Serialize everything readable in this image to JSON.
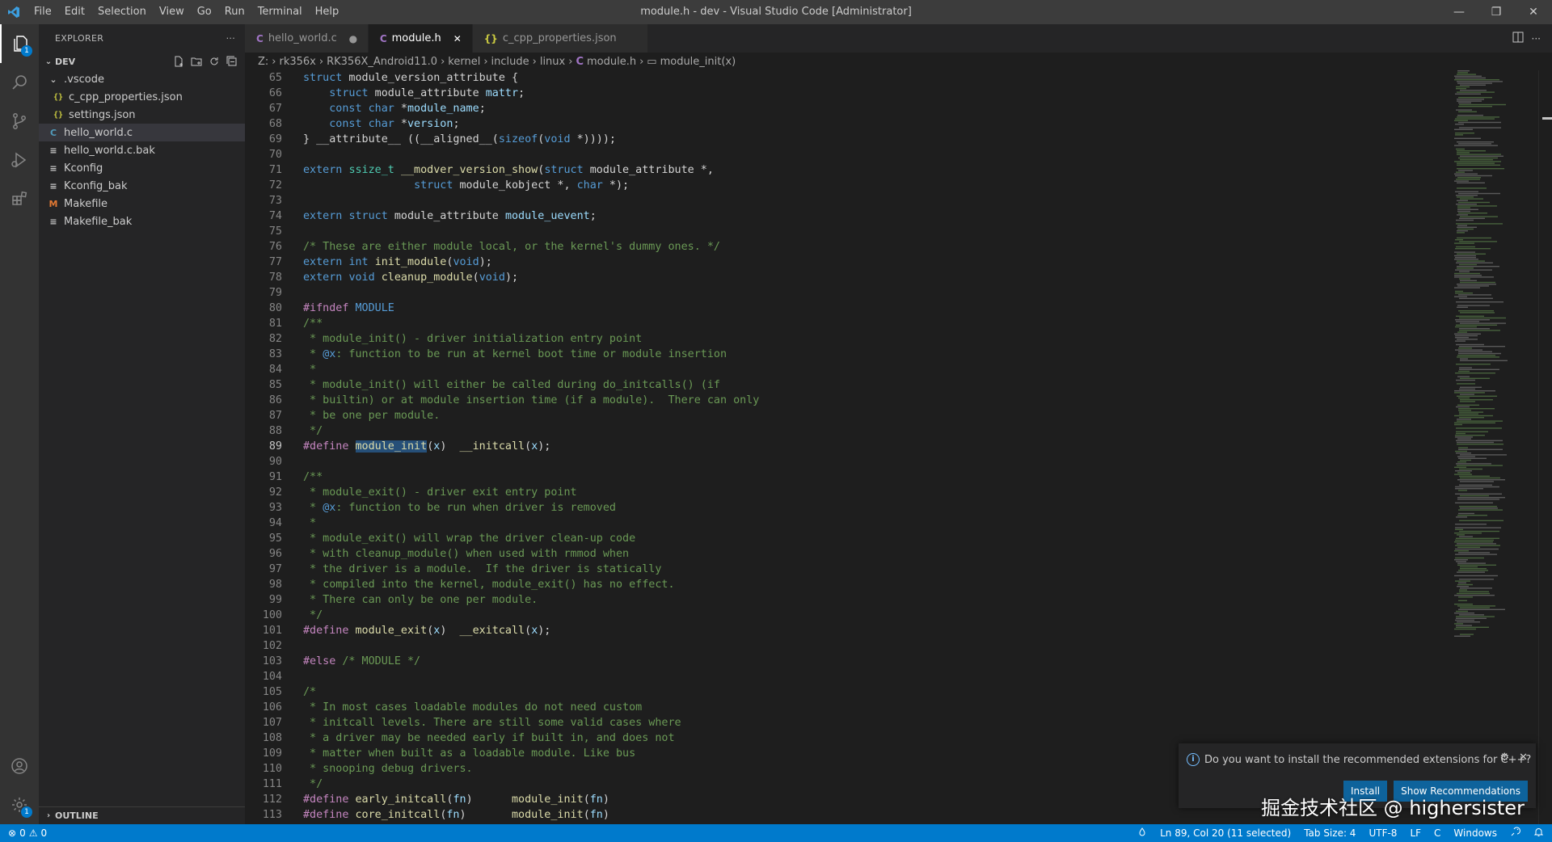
{
  "titlebar": {
    "title": "module.h - dev - Visual Studio Code [Administrator]",
    "menu": [
      "File",
      "Edit",
      "Selection",
      "View",
      "Go",
      "Run",
      "Terminal",
      "Help"
    ],
    "minimize": "—",
    "restore": "❐",
    "close": "✕"
  },
  "activity": {
    "explorer_badge": "1",
    "settings_badge": "1"
  },
  "sidebar": {
    "header": "EXPLORER",
    "more": "···",
    "section": "DEV",
    "tree": [
      {
        "label": ".vscode",
        "icon": "folder-open",
        "indent": 1
      },
      {
        "label": "c_cpp_properties.json",
        "icon": "json",
        "indent": 2
      },
      {
        "label": "settings.json",
        "icon": "json",
        "indent": 2
      },
      {
        "label": "hello_world.c",
        "icon": "c",
        "indent": 1,
        "selected": true
      },
      {
        "label": "hello_world.c.bak",
        "icon": "file",
        "indent": 1
      },
      {
        "label": "Kconfig",
        "icon": "file",
        "indent": 1
      },
      {
        "label": "Kconfig_bak",
        "icon": "file",
        "indent": 1
      },
      {
        "label": "Makefile",
        "icon": "makefile",
        "indent": 1
      },
      {
        "label": "Makefile_bak",
        "icon": "file",
        "indent": 1
      }
    ],
    "outline": "OUTLINE"
  },
  "tabs": [
    {
      "label": "hello_world.c",
      "icon": "C",
      "state": "●",
      "active": false
    },
    {
      "label": "module.h",
      "icon": "C",
      "state": "✕",
      "active": true
    },
    {
      "label": "c_cpp_properties.json",
      "icon": "{}",
      "state": "",
      "active": false
    }
  ],
  "breadcrumb": [
    "Z:",
    "rk356x",
    "RK356X_Android11.0",
    "kernel",
    "include",
    "linux",
    "module.h",
    "module_init(x)"
  ],
  "code": [
    {
      "n": "65",
      "t": [
        [
          "kw",
          "struct"
        ],
        [
          "",
          " module_version_attribute {"
        ]
      ]
    },
    {
      "n": "66",
      "t": [
        [
          "",
          "    "
        ],
        [
          "kw",
          "struct"
        ],
        [
          "",
          " module_attribute "
        ],
        [
          "pn",
          "mattr"
        ],
        [
          "",
          ";"
        ]
      ]
    },
    {
      "n": "67",
      "t": [
        [
          "",
          "    "
        ],
        [
          "kw",
          "const"
        ],
        [
          "",
          " "
        ],
        [
          "kw",
          "char"
        ],
        [
          "",
          " *"
        ],
        [
          "pn",
          "module_name"
        ],
        [
          "",
          ";"
        ]
      ]
    },
    {
      "n": "68",
      "t": [
        [
          "",
          "    "
        ],
        [
          "kw",
          "const"
        ],
        [
          "",
          " "
        ],
        [
          "kw",
          "char"
        ],
        [
          "",
          " *"
        ],
        [
          "pn",
          "version"
        ],
        [
          "",
          ";"
        ]
      ]
    },
    {
      "n": "69",
      "t": [
        [
          "",
          "} __attribute__ ((__aligned__("
        ],
        [
          "kw",
          "sizeof"
        ],
        [
          "",
          "("
        ],
        [
          "kw",
          "void"
        ],
        [
          "",
          " *))));"
        ]
      ]
    },
    {
      "n": "70",
      "t": []
    },
    {
      "n": "71",
      "t": [
        [
          "kw",
          "extern"
        ],
        [
          "",
          " "
        ],
        [
          "ty",
          "ssize_t"
        ],
        [
          "",
          " "
        ],
        [
          "fn",
          "__modver_version_show"
        ],
        [
          "",
          "("
        ],
        [
          "kw",
          "struct"
        ],
        [
          "",
          " module_attribute *,"
        ]
      ]
    },
    {
      "n": "72",
      "t": [
        [
          "",
          "                 "
        ],
        [
          "kw",
          "struct"
        ],
        [
          "",
          " module_kobject *, "
        ],
        [
          "kw",
          "char"
        ],
        [
          "",
          " *);"
        ]
      ]
    },
    {
      "n": "73",
      "t": []
    },
    {
      "n": "74",
      "t": [
        [
          "kw",
          "extern"
        ],
        [
          "",
          " "
        ],
        [
          "kw",
          "struct"
        ],
        [
          "",
          " module_attribute "
        ],
        [
          "pn",
          "module_uevent"
        ],
        [
          "",
          ";"
        ]
      ]
    },
    {
      "n": "75",
      "t": []
    },
    {
      "n": "76",
      "t": [
        [
          "cm",
          "/* These are either module local, or the kernel's dummy ones. */"
        ]
      ]
    },
    {
      "n": "77",
      "t": [
        [
          "kw",
          "extern"
        ],
        [
          "",
          " "
        ],
        [
          "kw",
          "int"
        ],
        [
          "",
          " "
        ],
        [
          "fn",
          "init_module"
        ],
        [
          "",
          "("
        ],
        [
          "kw",
          "void"
        ],
        [
          "",
          ");"
        ]
      ]
    },
    {
      "n": "78",
      "t": [
        [
          "kw",
          "extern"
        ],
        [
          "",
          " "
        ],
        [
          "kw",
          "void"
        ],
        [
          "",
          " "
        ],
        [
          "fn",
          "cleanup_module"
        ],
        [
          "",
          "("
        ],
        [
          "kw",
          "void"
        ],
        [
          "",
          ");"
        ]
      ]
    },
    {
      "n": "79",
      "t": []
    },
    {
      "n": "80",
      "t": [
        [
          "pp",
          "#ifndef"
        ],
        [
          "",
          " "
        ],
        [
          "kw",
          "MODULE"
        ]
      ]
    },
    {
      "n": "81",
      "t": [
        [
          "cm",
          "/**"
        ]
      ]
    },
    {
      "n": "82",
      "t": [
        [
          "cm",
          " * module_init() - driver initialization entry point"
        ]
      ]
    },
    {
      "n": "83",
      "t": [
        [
          "cm",
          " * "
        ],
        [
          "kw",
          "@x"
        ],
        [
          "cm",
          ": function to be run at kernel boot time or module insertion"
        ]
      ]
    },
    {
      "n": "84",
      "t": [
        [
          "cm",
          " *"
        ]
      ]
    },
    {
      "n": "85",
      "t": [
        [
          "cm",
          " * module_init() will either be called during do_initcalls() (if"
        ]
      ]
    },
    {
      "n": "86",
      "t": [
        [
          "cm",
          " * builtin) or at module insertion time (if a module).  There can only"
        ]
      ]
    },
    {
      "n": "87",
      "t": [
        [
          "cm",
          " * be one per module."
        ]
      ]
    },
    {
      "n": "88",
      "t": [
        [
          "cm",
          " */"
        ]
      ]
    },
    {
      "n": "89",
      "t": [
        [
          "pp",
          "#define"
        ],
        [
          "",
          " "
        ],
        [
          "fnhl",
          "module_init"
        ],
        [
          "",
          "("
        ],
        [
          "pn",
          "x"
        ],
        [
          "",
          ")  "
        ],
        [
          "fn",
          "__initcall"
        ],
        [
          "",
          "("
        ],
        [
          "pn",
          "x"
        ],
        [
          "",
          ");"
        ]
      ],
      "cur": true
    },
    {
      "n": "90",
      "t": []
    },
    {
      "n": "91",
      "t": [
        [
          "cm",
          "/**"
        ]
      ]
    },
    {
      "n": "92",
      "t": [
        [
          "cm",
          " * module_exit() - driver exit entry point"
        ]
      ]
    },
    {
      "n": "93",
      "t": [
        [
          "cm",
          " * "
        ],
        [
          "kw",
          "@x"
        ],
        [
          "cm",
          ": function to be run when driver is removed"
        ]
      ]
    },
    {
      "n": "94",
      "t": [
        [
          "cm",
          " *"
        ]
      ]
    },
    {
      "n": "95",
      "t": [
        [
          "cm",
          " * module_exit() will wrap the driver clean-up code"
        ]
      ]
    },
    {
      "n": "96",
      "t": [
        [
          "cm",
          " * with cleanup_module() when used with rmmod when"
        ]
      ]
    },
    {
      "n": "97",
      "t": [
        [
          "cm",
          " * the driver is a module.  If the driver is statically"
        ]
      ]
    },
    {
      "n": "98",
      "t": [
        [
          "cm",
          " * compiled into the kernel, module_exit() has no effect."
        ]
      ]
    },
    {
      "n": "99",
      "t": [
        [
          "cm",
          " * There can only be one per module."
        ]
      ]
    },
    {
      "n": "100",
      "t": [
        [
          "cm",
          " */"
        ]
      ]
    },
    {
      "n": "101",
      "t": [
        [
          "pp",
          "#define"
        ],
        [
          "",
          " "
        ],
        [
          "fn",
          "module_exit"
        ],
        [
          "",
          "("
        ],
        [
          "pn",
          "x"
        ],
        [
          "",
          ")  "
        ],
        [
          "fn",
          "__exitcall"
        ],
        [
          "",
          "("
        ],
        [
          "pn",
          "x"
        ],
        [
          "",
          ");"
        ]
      ]
    },
    {
      "n": "102",
      "t": []
    },
    {
      "n": "103",
      "t": [
        [
          "pp",
          "#else"
        ],
        [
          "",
          " "
        ],
        [
          "cm",
          "/* MODULE */"
        ]
      ]
    },
    {
      "n": "104",
      "t": []
    },
    {
      "n": "105",
      "t": [
        [
          "cm",
          "/*"
        ]
      ]
    },
    {
      "n": "106",
      "t": [
        [
          "cm",
          " * In most cases loadable modules do not need custom"
        ]
      ]
    },
    {
      "n": "107",
      "t": [
        [
          "cm",
          " * initcall levels. There are still some valid cases where"
        ]
      ]
    },
    {
      "n": "108",
      "t": [
        [
          "cm",
          " * a driver may be needed early if built in, and does not"
        ]
      ]
    },
    {
      "n": "109",
      "t": [
        [
          "cm",
          " * matter when built as a loadable module. Like bus"
        ]
      ]
    },
    {
      "n": "110",
      "t": [
        [
          "cm",
          " * snooping debug drivers."
        ]
      ]
    },
    {
      "n": "111",
      "t": [
        [
          "cm",
          " */"
        ]
      ]
    },
    {
      "n": "112",
      "t": [
        [
          "pp",
          "#define"
        ],
        [
          "",
          " "
        ],
        [
          "fn",
          "early_initcall"
        ],
        [
          "",
          "("
        ],
        [
          "pn",
          "fn"
        ],
        [
          "",
          ")      "
        ],
        [
          "fn",
          "module_init"
        ],
        [
          "",
          "("
        ],
        [
          "pn",
          "fn"
        ],
        [
          "",
          ")"
        ]
      ]
    },
    {
      "n": "113",
      "t": [
        [
          "pp",
          "#define"
        ],
        [
          "",
          " "
        ],
        [
          "fn",
          "core_initcall"
        ],
        [
          "",
          "("
        ],
        [
          "pn",
          "fn"
        ],
        [
          "",
          ")       "
        ],
        [
          "fn",
          "module_init"
        ],
        [
          "",
          "("
        ],
        [
          "pn",
          "fn"
        ],
        [
          "",
          ")"
        ]
      ]
    }
  ],
  "notification": {
    "message": "Do you want to install the recommended extensions for C++?",
    "install": "Install",
    "show": "Show Recommendations"
  },
  "watermark": "掘金技术社区 @ highersister",
  "statusbar": {
    "errors": "0",
    "warnings": "0",
    "position": "Ln 89, Col 20 (11 selected)",
    "tab_size": "Tab Size: 4",
    "encoding": "UTF-8",
    "eol": "LF",
    "language": "C",
    "platform": "Windows"
  },
  "colors": {
    "accent": "#007acc",
    "keyword": "#569cd6",
    "comment": "#6a9955",
    "function": "#dcdcaa"
  }
}
